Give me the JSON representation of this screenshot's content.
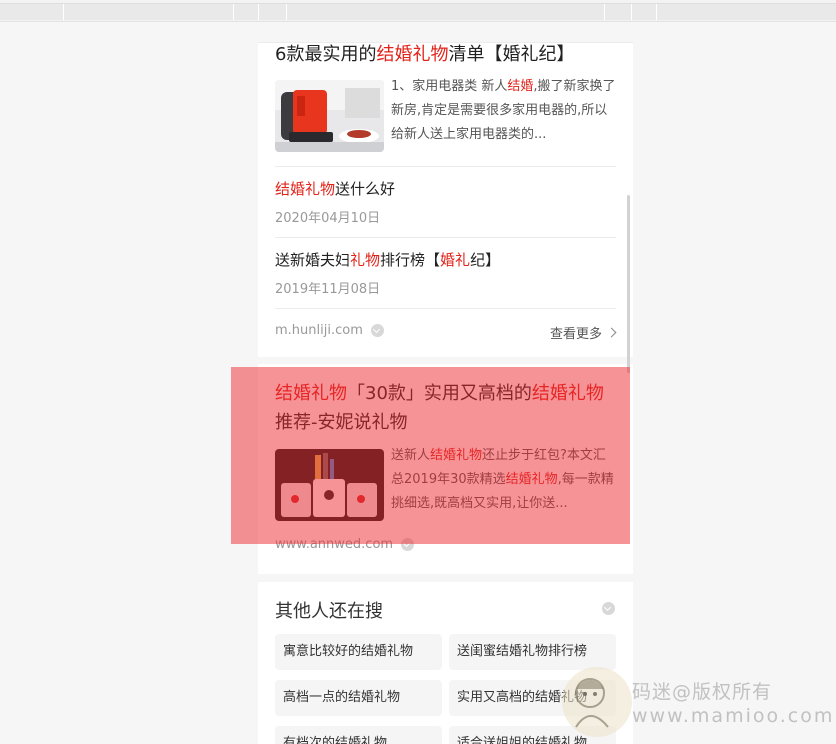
{
  "results": [
    {
      "title_parts": [
        {
          "text": "6款最实用的",
          "hl": false
        },
        {
          "text": "结婚礼物",
          "hl": true
        },
        {
          "text": "清单【婚礼纪】",
          "hl": false
        }
      ],
      "summary_parts": [
        {
          "text": "1、家用电器类 新人",
          "hl": false
        },
        {
          "text": "结婚",
          "hl": true
        },
        {
          "text": ",搬了新家换了新房,肯定是需要很多家用电器的,所以给新人送上家用电器类的...",
          "hl": false
        }
      ],
      "thumbnail": "coffee-machine-image",
      "sub_links": [
        {
          "title_parts": [
            {
              "text": "结婚礼物",
              "hl": true
            },
            {
              "text": "送什么好",
              "hl": false
            }
          ],
          "date": "2020年04月10日"
        },
        {
          "title_parts": [
            {
              "text": "送新婚夫妇",
              "hl": false
            },
            {
              "text": "礼物",
              "hl": true
            },
            {
              "text": "排行榜【",
              "hl": false
            },
            {
              "text": "婚礼",
              "hl": true
            },
            {
              "text": "纪】",
              "hl": false
            }
          ],
          "date": "2019年11月08日"
        }
      ],
      "source": "m.hunliji.com",
      "more_label": "查看更多"
    },
    {
      "title_parts": [
        {
          "text": "结婚礼物",
          "hl": true
        },
        {
          "text": "「30款」实用又高档的",
          "hl": false
        },
        {
          "text": "结婚礼物",
          "hl": true
        },
        {
          "text": "推荐-安妮说礼物",
          "hl": false
        }
      ],
      "summary_parts": [
        {
          "text": "送新人",
          "hl": false
        },
        {
          "text": "结婚礼物",
          "hl": true
        },
        {
          "text": "还止步于红包?本文汇总2019年30款精选",
          "hl": false
        },
        {
          "text": "结婚礼物",
          "hl": true
        },
        {
          "text": ",每一款精挑细选,既高档又实用,让你送...",
          "hl": false
        }
      ],
      "thumbnail": "mugs-gift-image",
      "source": "www.annwed.com"
    }
  ],
  "related": {
    "title": "其他人还在搜",
    "items": [
      "寓意比较好的结婚礼物",
      "送闺蜜结婚礼物排行榜",
      "高档一点的结婚礼物",
      "实用又高档的结婚礼物",
      "有档次的结婚礼物",
      "适合送姐姐的结婚礼物"
    ]
  },
  "watermark": {
    "line1": "码迷@版权所有",
    "line2": "www.mamioo.com"
  },
  "colors": {
    "highlight": "#e2231a",
    "overlay": "#ec2830"
  }
}
